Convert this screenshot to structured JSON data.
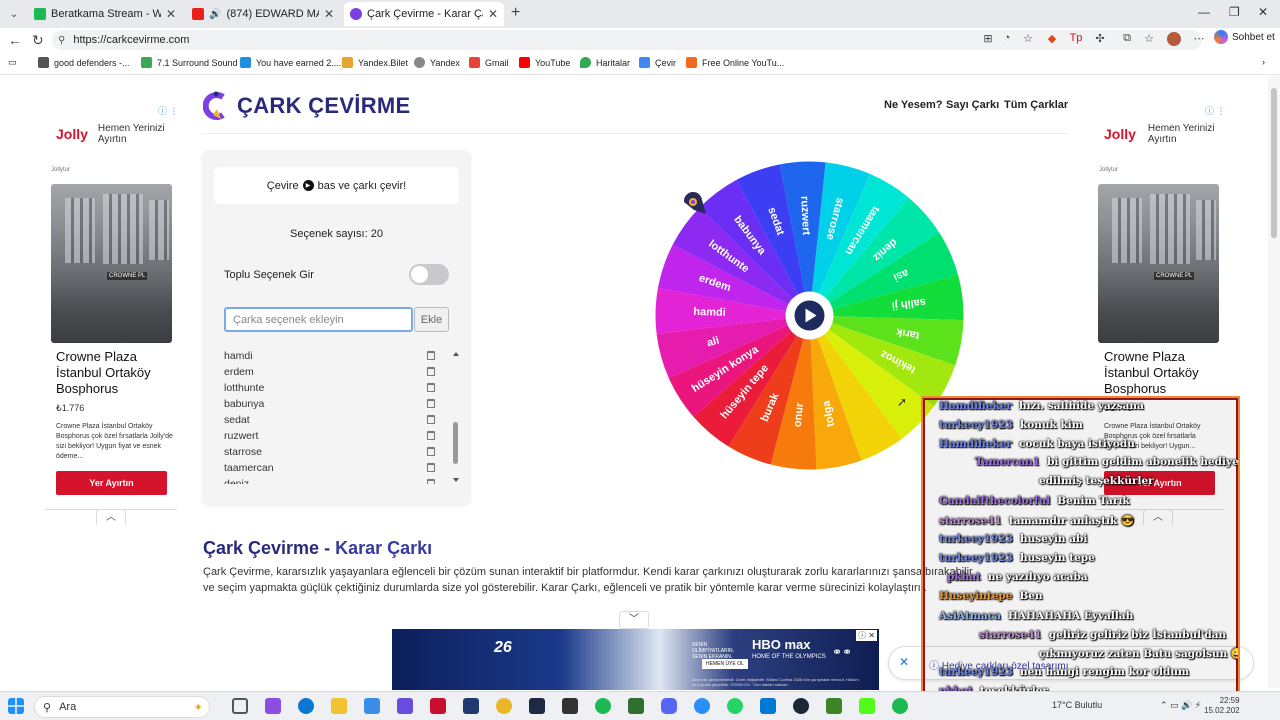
{
  "browser": {
    "tabs": [
      {
        "label": "Beratkama Stream - Watch Live on",
        "color": "#1db954",
        "active": false
      },
      {
        "label": "(874) EDWARD MAYA & VIKA",
        "color": "#e62117",
        "active": false
      },
      {
        "label": "Çark Çevirme - Karar Çarkı!",
        "color": "#7b3fe4",
        "active": true
      }
    ],
    "url": "https://carkcevirme.com",
    "copilot_label": "Sohbet et",
    "bookmarks": [
      {
        "label": "good defenders -...",
        "color": "#555"
      },
      {
        "label": "7.1 Surround Sound",
        "color": "#3aa757"
      },
      {
        "label": "You have earned 2....",
        "color": "#1f8fe0"
      },
      {
        "label": "Yandex.Bilet",
        "color": "#e3a72f"
      },
      {
        "label": "Yandex",
        "color": "#888"
      },
      {
        "label": "Gmail",
        "color": "#ea4335"
      },
      {
        "label": "YouTube",
        "color": "#ff0000"
      },
      {
        "label": "Haritalar",
        "color": "#34a853"
      },
      {
        "label": "Çevir",
        "color": "#4285f4"
      },
      {
        "label": "Free Online YouTu...",
        "color": "#f26b1d"
      }
    ]
  },
  "ads": {
    "left": {
      "brand": "Jolly",
      "tagline": "Hemen Yerinizi Ayırtın",
      "small": "Jollytur",
      "hotel": "Crowne Plaza İstanbul Ortaköy Bosphorus",
      "price": "₺1.776",
      "desc": "Crowne Plaza İstanbul Ortaköy Bosphorus çok özel fırsatlarla Jolly'de sizi bekliyor! Uygun fiyat ve esnek ödeme...",
      "button": "Yer Ayırtın"
    },
    "right": {
      "brand": "Jolly",
      "tagline": "Hemen Yerinizi Ayırtın",
      "small": "Jollytur",
      "hotel": "Crowne Plaza İstanbul Ortaköy Bosphorus",
      "price": "₺1.776",
      "desc": "Crowne Plaza İstanbul Ortaköy Bosphorus çok özel fırsatlarla Jolly'de sizi bekliyor! Uygun...",
      "button": "Yer Ayırtın"
    },
    "info_icon": "ⓘ ⋮"
  },
  "site": {
    "title": "ÇARK ÇEVİRME",
    "nav": [
      "Ne Yesem?",
      "Sayı Çarkı",
      "Tüm Çarklar"
    ]
  },
  "card": {
    "cevir_prefix": "Çevire",
    "cevir_suffix": "bas ve çarkı çevir!",
    "count_label": "Seçenek sayısı: 20",
    "toplu_label": "Toplu Seçenek Gir",
    "input_placeholder": "Çarka seçenek ekleyin",
    "add_button": "Ekle",
    "visible_options": [
      "hamdi",
      "erdem",
      "lotthunte",
      "babunya",
      "sedat",
      "ruzwert",
      "starrose",
      "taamercan",
      "deniz"
    ]
  },
  "wheel": {
    "segments": [
      {
        "label": "starrose",
        "color": "#00d0e8"
      },
      {
        "label": "taamercan",
        "color": "#00e6d6"
      },
      {
        "label": "deniz",
        "color": "#00e6a8"
      },
      {
        "label": "asi",
        "color": "#00e070"
      },
      {
        "label": "salih ji",
        "color": "#12dd3a"
      },
      {
        "label": "tarık",
        "color": "#5be21a"
      },
      {
        "label": "tekinoz",
        "color": "#a2e80e"
      },
      {
        "label": "",
        "color": "#d8ef0a"
      },
      {
        "label": "",
        "color": "#f2d308"
      },
      {
        "label": "tolga",
        "color": "#f8a808"
      },
      {
        "label": "onur",
        "color": "#f67a0c"
      },
      {
        "label": "burak",
        "color": "#ee3d1a"
      },
      {
        "label": "hüseyin tepe",
        "color": "#ea1c3a"
      },
      {
        "label": "hüseyin konya",
        "color": "#ea167e"
      },
      {
        "label": "ali",
        "color": "#e61cae"
      },
      {
        "label": "hamdi",
        "color": "#e224d6"
      },
      {
        "label": "erdem",
        "color": "#c025ee"
      },
      {
        "label": "lotthunte",
        "color": "#8c2af2"
      },
      {
        "label": "babunya",
        "color": "#6a2ef4"
      },
      {
        "label": "sedat",
        "color": "#3b3ef2"
      },
      {
        "label": "ruzwert",
        "color": "#1f66ee"
      }
    ]
  },
  "content": {
    "heading_a": "Çark Çevirme - ",
    "heading_b": "Karar Çarkı",
    "paragraph": "Çark Çevirme, kararsızlık yaşayanlara eğlenceli bir çözüm sunan interaktif bir platformdur. Kendi karar çarkınızı oluşturarak zorlu kararlarınızı şansa bırakabilir ve seçim yapmakta güçlük çektiğiniz durumlarda size yol gösterebilir. Karar Çarkı, eğlenceli ve pratik bir yöntemle karar verme sürecinizi kolaylaştırır."
  },
  "promo": {
    "hediye": "Hediye çarkları özel tasarımı",
    "banner_brand": "HBO max",
    "banner_sub": "HOME OF THE OLYMPICS",
    "banner_btn": "HEMEN ÜYE OL",
    "banner_small": "SENİN OLİMPİYATLARIN. SENİN EKRANIN.",
    "banner_fine": "Abonelik gerekmektedir. Ücret değişebilir. Milano Cortina 2026 tüm yarışmalar mevcut. Hüküm ve koşullar geçerlidir. ©2026 IOC. Tüm hakları saklıdır."
  },
  "chat": [
    {
      "user": "Hamdifieker",
      "text": "hızı. salıhide yazsana",
      "ucolor": "c-blue"
    },
    {
      "user": "turkeey1923",
      "text": "konuk kim",
      "ucolor": "c-blue"
    },
    {
      "user": "Hamdifieker",
      "text": "cocuk baya istiyodu",
      "ucolor": "c-blue"
    },
    {
      "user": "Tamercan1",
      "text": "bi gittim geldim abonelik hediye",
      "ucolor": "c-purple"
    },
    {
      "user": "",
      "text": "edilmiş teşekkürler",
      "ucolor": "c-purple"
    },
    {
      "user": "Gandalfthecolorful",
      "text": "Benim Tarık",
      "ucolor": "c-purple"
    },
    {
      "user": "starrose41",
      "text": "tamamdır anlaştık 😎",
      "ucolor": "c-pink"
    },
    {
      "user": "turkeey1923",
      "text": "huseyin abi",
      "ucolor": "c-blue"
    },
    {
      "user": "turkeey1923",
      "text": "huseyin tepe",
      "ucolor": "c-blue"
    },
    {
      "user": "pkhat",
      "text": "ne yazılıyo acaba",
      "ucolor": "c-purple"
    },
    {
      "user": "Huseyintepe",
      "text": "Ben",
      "ucolor": "c-orange"
    },
    {
      "user": "AsiAtmaca",
      "text": "HAHAHAHA Eyvallah",
      "ucolor": "c-lblue"
    },
    {
      "user": "starrose41",
      "text": "geliriz geliriz biz İstanbul'dan",
      "ucolor": "c-pink"
    },
    {
      "user": "",
      "text": "çıkmıyoruz zaten Batu sagolsun 😀",
      "ucolor": "c-pink"
    },
    {
      "user": "turkeey1923",
      "text": "nen hangi rengim kor oldum",
      "ucolor": "c-blue"
    },
    {
      "user": "pkhat",
      "text": "teşekkürler",
      "ucolor": "c-purple"
    }
  ],
  "taskbar": {
    "search_label": "Ara",
    "weather": "17°C  Bulutlu",
    "time": "22:59",
    "date": "15.02.202"
  }
}
